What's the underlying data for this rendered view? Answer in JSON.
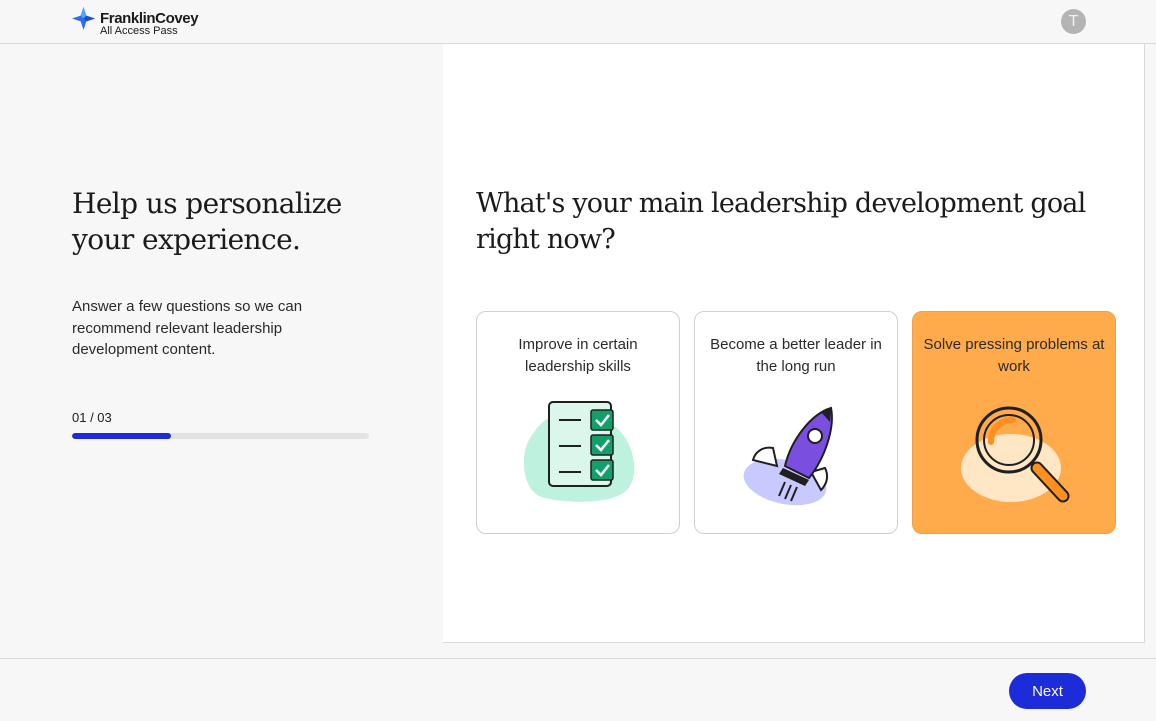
{
  "header": {
    "brand_name": "FranklinCovey",
    "brand_sub": "All Access Pass",
    "avatar_initial": "T"
  },
  "intro": {
    "title": "Help us personalize your experience.",
    "description": "Answer a few questions so we can recommend relevant leadership development content.",
    "step": "01 / 03",
    "progress_fraction": 0.333
  },
  "question": {
    "text": "What's your main leadership development goal right now?",
    "options": [
      {
        "label": "Improve in certain leadership skills",
        "icon": "checklist-icon",
        "selected": false
      },
      {
        "label": "Become a better leader in the long run",
        "icon": "rocket-icon",
        "selected": false
      },
      {
        "label": "Solve pressing problems at work",
        "icon": "magnifier-icon",
        "selected": true
      }
    ]
  },
  "footer": {
    "next_label": "Next"
  },
  "colors": {
    "accent": "#1d2cd9",
    "selected_card": "#ffab4c",
    "progress_track": "#e2e2e2"
  }
}
